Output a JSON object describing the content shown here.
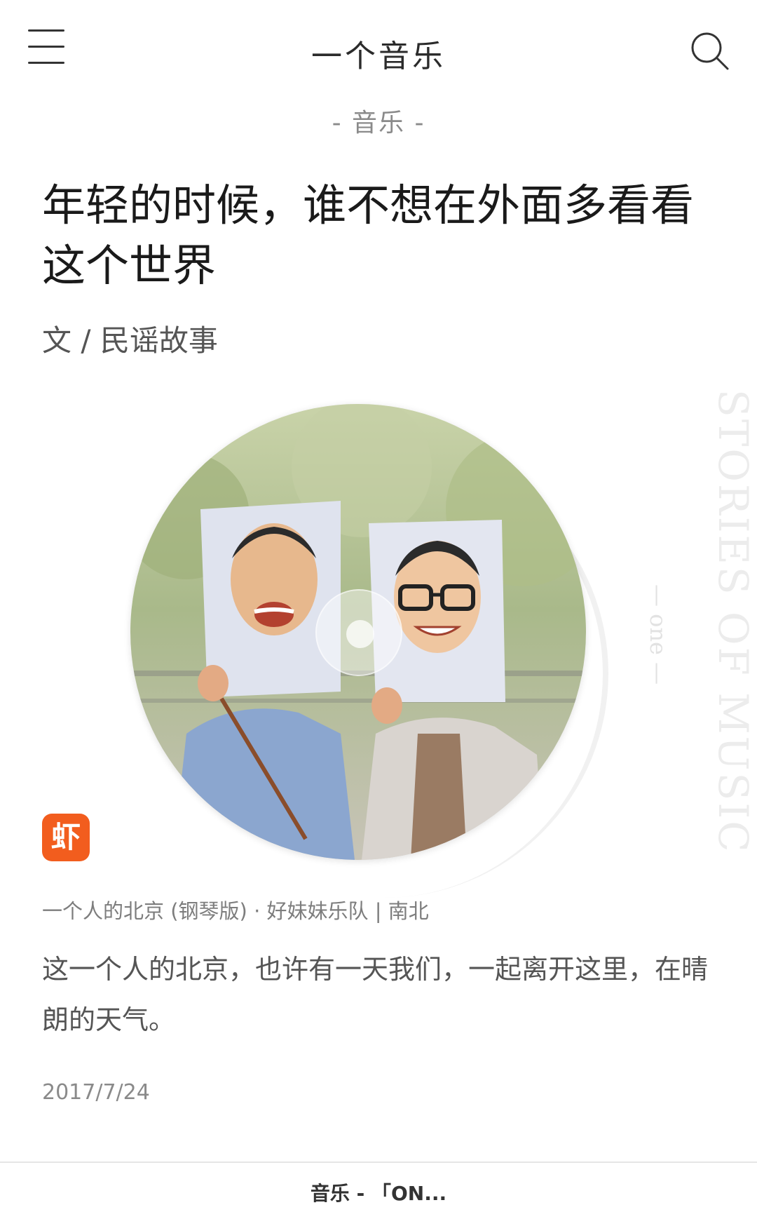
{
  "header": {
    "title": "一个音乐",
    "menu_icon": "menu-icon",
    "search_icon": "search-icon"
  },
  "section_label": "- 音乐 -",
  "article": {
    "title": "年轻的时候，谁不想在外面多看看这个世界",
    "author": "文 / 民谣故事"
  },
  "album": {
    "vertical_caption": "STORIES OF MUSIC",
    "one_mark": "— one —",
    "source_logo_text": "虾",
    "source_logo_color": "#f25d1e"
  },
  "song_info": "一个人的北京 (钢琴版) · 好妹妹乐队 | 南北",
  "description": "这一个人的北京，也许有一天我们，一起离开这里，在晴朗的天气。",
  "date": "2017/7/24",
  "bottom_bar": {
    "text": "音乐 - 「ON..."
  }
}
